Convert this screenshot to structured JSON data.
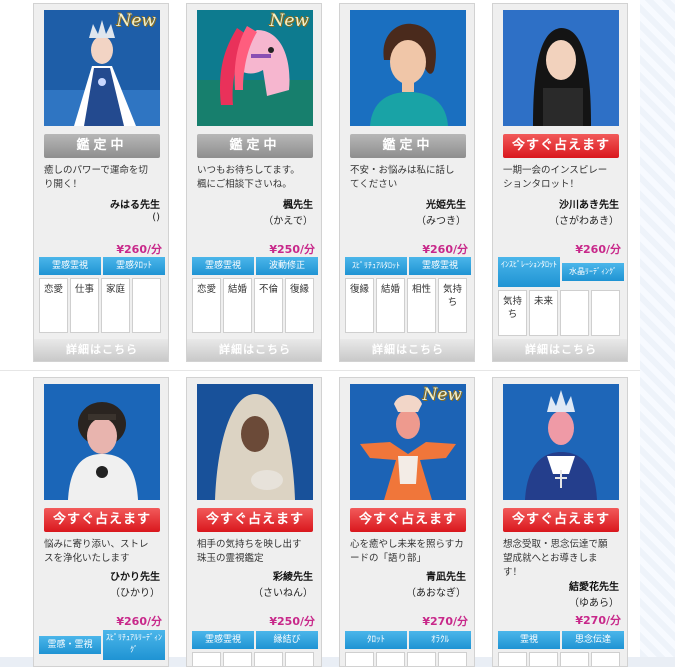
{
  "colors": {
    "price": "#c8288a",
    "status_busy": "#9a9a9a",
    "status_available": "#e3262c",
    "genre_tag": "#2f9fde"
  },
  "cards": [
    {
      "name": "みはる先生",
      "reading": "()",
      "price": "¥260/分",
      "status": "鑑定中",
      "new": "New",
      "desc": [
        "癒しのパワーで運命を切",
        "り開く！"
      ],
      "tags": [
        "霊感霊視",
        "霊感ﾀﾛｯﾄ"
      ],
      "cells": [
        "恋愛",
        "仕事",
        "家庭"
      ],
      "detail": "詳細はこちら",
      "photo": "queen-figure-icon"
    },
    {
      "name": "楓先生",
      "reading": "（かえで）",
      "price": "¥250/分",
      "status": "鑑定中",
      "new": "New",
      "desc": [
        "いつもお待ちしてます。",
        "楓にご相談下さいね。"
      ],
      "tags": [
        "霊感霊視",
        "波動修正"
      ],
      "cells": [
        "恋愛",
        "結婚",
        "不倫",
        "復縁"
      ],
      "detail": "詳細はこちら",
      "photo": "pink-horse-icon"
    },
    {
      "name": "光姫先生",
      "reading": "（みつき）",
      "price": "¥260/分",
      "status": "鑑定中",
      "desc": [
        "不安・お悩みは私に話し",
        "てください"
      ],
      "tags": [
        "ｽﾋﾟﾘﾁｭｱﾙﾀﾛｯﾄ",
        "霊感霊視"
      ],
      "cells": [
        "復縁",
        "結婚",
        "相性",
        "気持ち"
      ],
      "detail": "詳細はこちら",
      "photo": "woman-portrait-icon"
    },
    {
      "name": "沙川あき先生",
      "reading": "（さがわあき）",
      "price": "¥260/分",
      "status": "今すぐ占えます",
      "desc": [
        "一期一会のインスピレー",
        "ションタロット！"
      ],
      "tags": [
        "ｲﾝｽﾋﾟﾚｰｼｮﾝﾀﾛｯﾄ",
        "水晶ﾘｰﾃﾞｨﾝｸﾞ"
      ],
      "cells": [
        "気持ち",
        "未来"
      ],
      "detail": "詳細はこちら",
      "photo": "woman-dark-hair-icon"
    },
    {
      "name": "ひかり先生",
      "reading": "（ひかり）",
      "price": "¥260/分",
      "status": "今すぐ占えます",
      "desc": [
        "悩みに寄り添い、ストレ",
        "スを浄化いたします"
      ],
      "tags": [
        "霊感・霊視",
        "ｽﾋﾟﾘﾁｭｱﾙﾘｰﾃﾞｨﾝｸﾞ"
      ],
      "photo": "doll-figure-icon"
    },
    {
      "name": "彩綾先生",
      "reading": "（さいねん）",
      "price": "¥250/分",
      "status": "今すぐ占えます",
      "desc": [
        "相手の気持ちを映し出す",
        "珠玉の霊視鑑定"
      ],
      "tags": [
        "霊感霊視",
        "縁結び"
      ],
      "photo": "veiled-woman-icon"
    },
    {
      "name": "青凪先生",
      "reading": "（あおなぎ）",
      "price": "¥270/分",
      "status": "今すぐ占えます",
      "new": "New",
      "desc": [
        "心を癒やし未来を照らすカ",
        "ードの「語り部」"
      ],
      "tags": [
        "ﾀﾛｯﾄ",
        "ｵﾗｸﾙ"
      ],
      "photo": "orange-figure-icon"
    },
    {
      "name": "結愛花先生",
      "reading": "（ゆあら）",
      "price": "¥270/分",
      "status": "今すぐ占えます",
      "desc": [
        "想念受取・思念伝達で願",
        "望成就へとお導きしま",
        "す！"
      ],
      "tags": [
        "霊視",
        "思念伝達"
      ],
      "photo": "crowned-doll-icon"
    }
  ]
}
